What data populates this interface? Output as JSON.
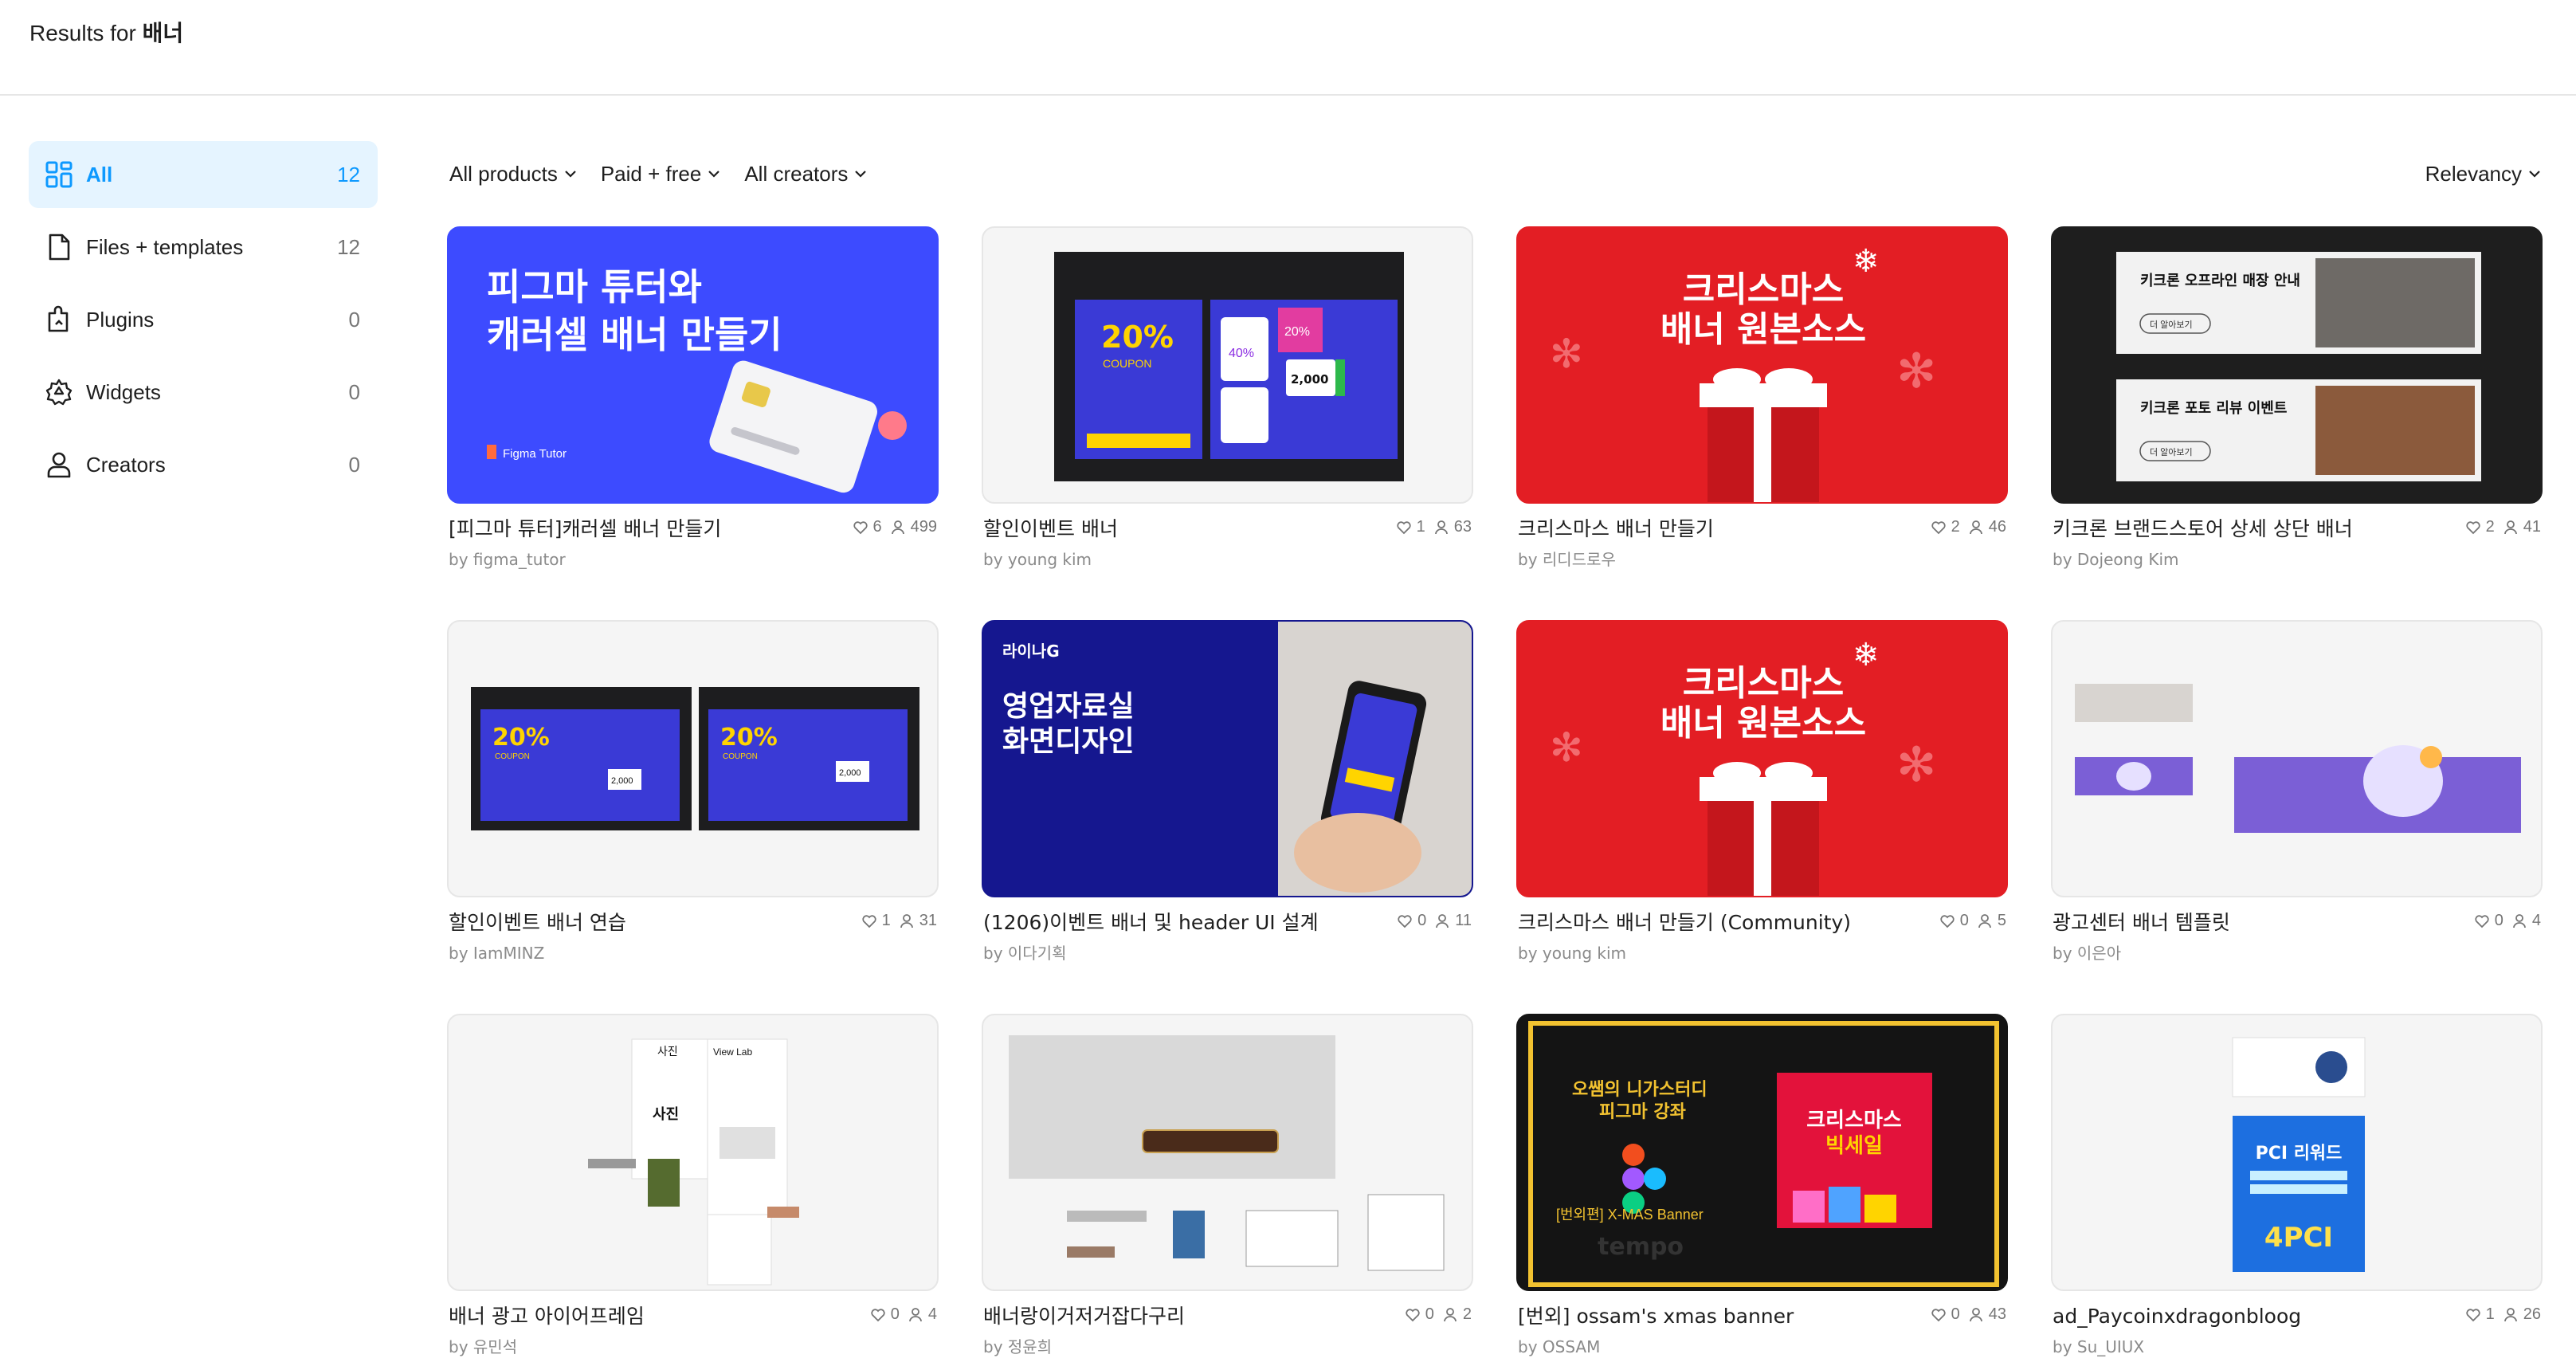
{
  "header": {
    "results_prefix": "Results for",
    "query": "배너"
  },
  "sidebar": {
    "items": [
      {
        "label": "All",
        "count": "12",
        "icon": "grid-icon"
      },
      {
        "label": "Files + templates",
        "count": "12",
        "icon": "file-icon"
      },
      {
        "label": "Plugins",
        "count": "0",
        "icon": "plugin-icon"
      },
      {
        "label": "Widgets",
        "count": "0",
        "icon": "widget-icon"
      },
      {
        "label": "Creators",
        "count": "0",
        "icon": "person-icon"
      }
    ]
  },
  "filters": {
    "products": "All products",
    "price": "Paid + free",
    "creators": "All creators",
    "sort": "Relevancy"
  },
  "cards": [
    {
      "title": "[피그마 튜터]캐러셀 배너 만들기",
      "by": "by figma_tutor",
      "likes": "6",
      "users": "499",
      "thumb": {
        "line1": "피그마 튜터와",
        "line2": "캐러셀 배너 만들기",
        "brand": "Figma Tutor"
      }
    },
    {
      "title": "할인이벤트 배너",
      "by": "by young kim",
      "likes": "1",
      "users": "63",
      "thumb": {
        "big": "20%",
        "coupon": "COUPON",
        "p1": "40%",
        "p2": "20%",
        "p3": "2,000"
      }
    },
    {
      "title": "크리스마스 배너 만들기",
      "by": "by 리디드로우",
      "likes": "2",
      "users": "46",
      "thumb": {
        "line1": "크리스마스",
        "line2": "배너 원본소스"
      }
    },
    {
      "title": "키크론 브랜드스토어 상세 상단 배너",
      "by": "by Dojeong Kim",
      "likes": "2",
      "users": "41",
      "thumb": {
        "a": "키크론 오프라인 매장 안내",
        "b": "키크론 포토 리뷰 이벤트",
        "btn": "더 알아보기"
      }
    },
    {
      "title": "할인이벤트 배너 연습",
      "by": "by IamMINZ",
      "likes": "1",
      "users": "31",
      "thumb": {
        "big": "20%",
        "coupon": "COUPON",
        "p3": "2,000"
      }
    },
    {
      "title": "(1206)이벤트 배너 및 header UI 설계",
      "by": "by 이다기획",
      "likes": "0",
      "users": "11",
      "thumb": {
        "brand": "라이나G",
        "line1": "영업자료실",
        "line2": "화면디자인"
      }
    },
    {
      "title": "크리스마스 배너 만들기 (Community)",
      "by": "by young kim",
      "likes": "0",
      "users": "5",
      "thumb": {
        "line1": "크리스마스",
        "line2": "배너 원본소스"
      }
    },
    {
      "title": "광고센터 배너 템플릿",
      "by": "by 이은아",
      "likes": "0",
      "users": "4",
      "thumb": {}
    },
    {
      "title": "배너 광고 아이어프레임",
      "by": "by 유민석",
      "likes": "0",
      "users": "4",
      "thumb": {
        "a": "사진",
        "b": "사진",
        "c": "View Lab"
      }
    },
    {
      "title": "배너랑이거저거잡다구리",
      "by": "by 정윤희",
      "likes": "0",
      "users": "2",
      "thumb": {}
    },
    {
      "title": "[번외] ossam's xmas banner",
      "by": "by OSSAM",
      "likes": "0",
      "users": "43",
      "thumb": {
        "l1": "오쌤의 니가스터디",
        "l2": "피그마 강좌",
        "l3": "[번외편] X-MAS Banner",
        "r1": "크리스마스",
        "r2": "빅세일",
        "tempo": "tempo"
      }
    },
    {
      "title": "ad_Paycoinxdragonbloog",
      "by": "by Su_UIUX",
      "likes": "1",
      "users": "26",
      "thumb": {
        "a": "PCI 리워드",
        "b": "4PCI"
      }
    }
  ],
  "colors": {
    "accent": "#0d99ff",
    "active_bg": "#e5f4ff",
    "xmas_red": "#e31e24",
    "coupon_blue": "#3a3ad6"
  }
}
